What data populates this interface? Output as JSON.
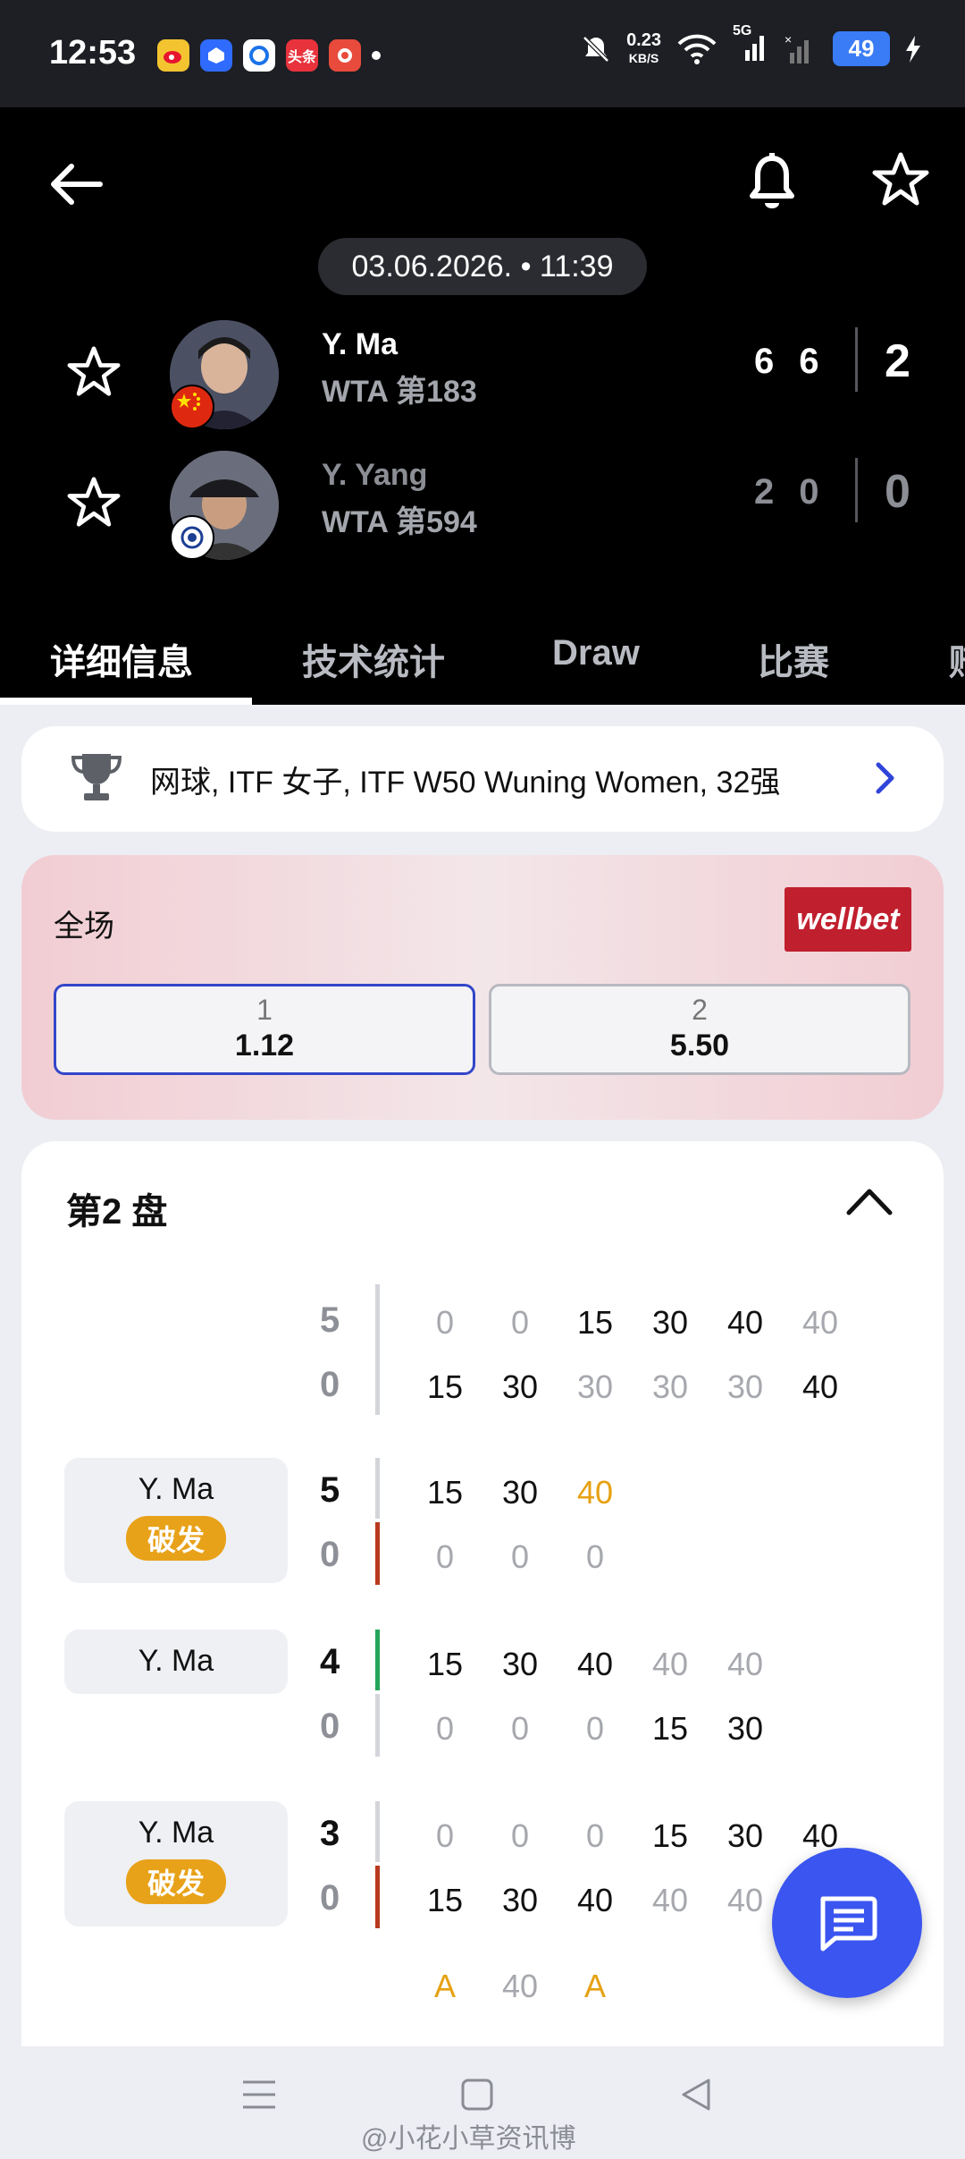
{
  "status_bar": {
    "time": "12:53",
    "net_speed": "0.23",
    "net_unit": "KB/S",
    "signal": "5G",
    "battery": "49",
    "apps": [
      "weibo-icon",
      "app-icon",
      "browser-icon",
      "头条",
      "game-icon"
    ]
  },
  "header": {
    "datetime": "03.06.2026. • 11:39",
    "players": [
      {
        "name": "Y. Ma",
        "rank": "WTA 第183",
        "sets": [
          "6",
          "6"
        ],
        "total": "2",
        "flag": "china-flag-icon"
      },
      {
        "name": "Y. Yang",
        "rank": "WTA 第594",
        "sets": [
          "2",
          "0"
        ],
        "total": "0",
        "flag": "taipei-flag-icon"
      }
    ]
  },
  "tabs": [
    "详细信息",
    "技术统计",
    "Draw",
    "比赛",
    "赔"
  ],
  "league": {
    "text": "网球, ITF 女子, ITF W50 Wuning Women, 32强"
  },
  "odds": {
    "title": "全场",
    "brand": "wellbet",
    "options": [
      {
        "label": "1",
        "value": "1.12"
      },
      {
        "label": "2",
        "value": "5.50"
      }
    ]
  },
  "set_section": {
    "title": "第2 盘",
    "games": [
      {
        "server": "",
        "break_label": "",
        "rows": [
          {
            "score": "5",
            "points": [
              "0",
              "0",
              "15",
              "30",
              "40",
              "40"
            ]
          },
          {
            "score": "0",
            "points": [
              "15",
              "30",
              "30",
              "30",
              "30",
              "40"
            ]
          }
        ]
      },
      {
        "server": "Y. Ma",
        "break_label": "破发",
        "rows": [
          {
            "score": "5",
            "points": [
              "15",
              "30",
              "40"
            ]
          },
          {
            "score": "0",
            "points": [
              "0",
              "0",
              "0"
            ]
          }
        ]
      },
      {
        "server": "Y. Ma",
        "break_label": "",
        "rows": [
          {
            "score": "4",
            "points": [
              "15",
              "30",
              "40",
              "40",
              "40"
            ]
          },
          {
            "score": "0",
            "points": [
              "0",
              "0",
              "0",
              "15",
              "30"
            ]
          }
        ]
      },
      {
        "server": "Y. Ma",
        "break_label": "破发",
        "rows": [
          {
            "score": "3",
            "points": [
              "0",
              "0",
              "0",
              "15",
              "30",
              "40"
            ]
          },
          {
            "score": "0",
            "points": [
              "15",
              "30",
              "40",
              "40",
              "40"
            ]
          }
        ],
        "extra": [
          "A",
          "40",
          "A"
        ]
      }
    ]
  },
  "watermark": "@小花小草资讯博",
  "colors": {
    "accent": "#3a55f0",
    "break": "#e8a219",
    "bar_red": "#b8391f",
    "bar_green": "#23a55a",
    "brand": "#c01f2e"
  }
}
